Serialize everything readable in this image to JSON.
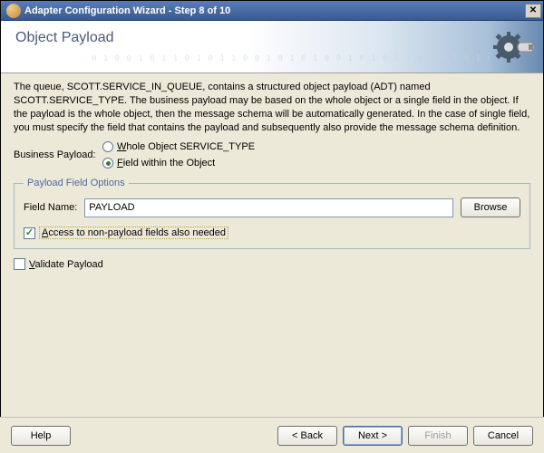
{
  "window": {
    "title": "Adapter Configuration Wizard - Step 8 of 10"
  },
  "banner": {
    "heading": "Object Payload",
    "deco": "0 1 0 0 1 0 1 1 0 1 0 1 1 0 0 1 0 1 0 1 0 0 1 0 1 0 1 1 0 1 0 1 0 1 0 1 0 0 1"
  },
  "description": "The queue, SCOTT.SERVICE_IN_QUEUE, contains a structured object payload (ADT) named SCOTT.SERVICE_TYPE. The business payload may be based on the whole object or a single field in the object. If the payload is the whole object, then the message schema will be automatically generated. In the case of single field, you must specify the field that contains the payload and subsequently also provide the message schema definition.",
  "business_payload": {
    "label": "Business Payload:",
    "whole": {
      "prefix": "W",
      "rest": "hole Object SERVICE_TYPE",
      "checked": false
    },
    "field": {
      "prefix": "F",
      "rest": "ield within the Object",
      "checked": true
    }
  },
  "payload_field_options": {
    "legend": "Payload Field Options",
    "field_name_label": "Field Name:",
    "field_name_value": "PAYLOAD",
    "browse": "Browse",
    "access_checkbox": {
      "checked": true,
      "prefix": "A",
      "rest": "ccess to non-payload fields also needed"
    }
  },
  "validate": {
    "checked": false,
    "prefix": "V",
    "rest": "alidate Payload"
  },
  "buttons": {
    "help": "Help",
    "back": "< Back",
    "next": "Next >",
    "finish": "Finish",
    "cancel": "Cancel"
  }
}
